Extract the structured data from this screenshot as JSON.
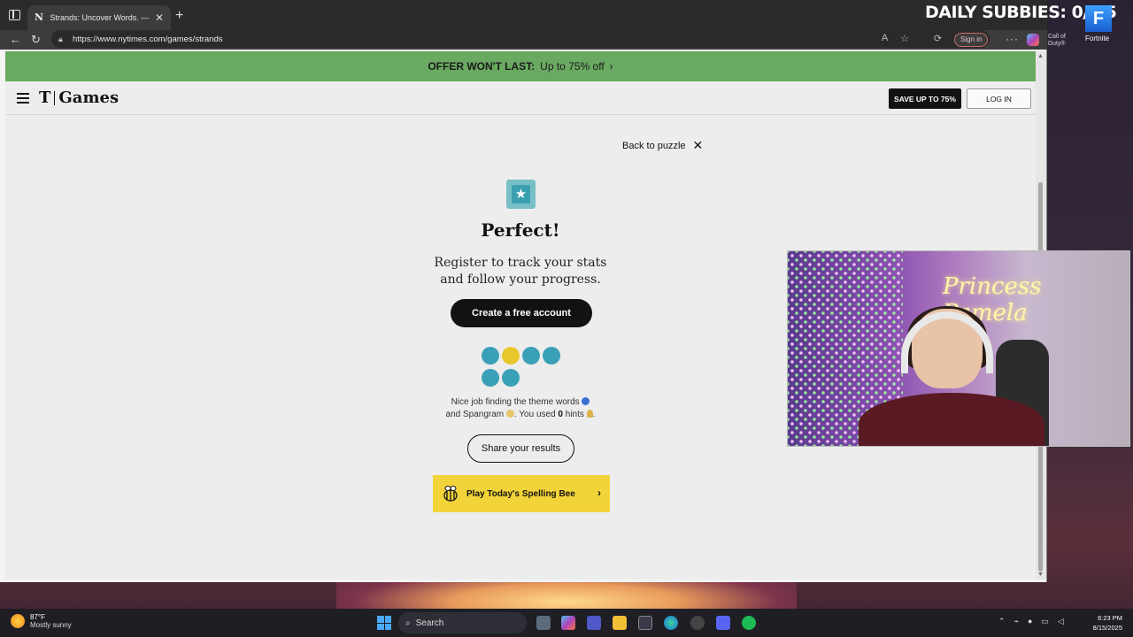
{
  "browser": {
    "tab_title": "Strands: Uncover Words. — The N",
    "tab_favicon": "N",
    "url": "https://www.nytimes.com/games/strands",
    "sign_in_label": "Sign in"
  },
  "offer_banner": {
    "label": "OFFER WON'T LAST:",
    "detail": "Up to 75% off"
  },
  "header": {
    "logo_t": "T",
    "logo_games": "Games",
    "save_label": "SAVE UP TO 75%",
    "login_label": "LOG IN"
  },
  "results": {
    "back_label": "Back to puzzle",
    "heading": "Perfect!",
    "register_line1": "Register to track your stats",
    "register_line2": "and follow your progress.",
    "create_account_label": "Create a free account",
    "summary_part1": "Nice job finding the theme words",
    "summary_part2": "and Spangram",
    "summary_part3": ". You used",
    "hints_used": "0",
    "summary_part4": "hints",
    "share_label": "Share your results",
    "spelling_bee_label": "Play Today's Spelling Bee",
    "word_dots": [
      "theme",
      "spangram",
      "theme",
      "theme",
      "theme",
      "theme"
    ]
  },
  "colors": {
    "theme_dot": "#3aa0b7",
    "spangram_dot": "#e8c72c",
    "offer_green": "#6aa961",
    "bee_yellow": "#f2d43a"
  },
  "overlay": {
    "subbies": "DAILY SUBBIES: 0/ 15",
    "fortnite_label": "Fortnite",
    "cod_label": "Call of Duty®",
    "neon_sign": "Princess Pamela"
  },
  "taskbar": {
    "temperature": "87°F",
    "weather": "Mostly sunny",
    "search_placeholder": "Search",
    "time": "6:23 PM",
    "date": "8/15/2025"
  }
}
